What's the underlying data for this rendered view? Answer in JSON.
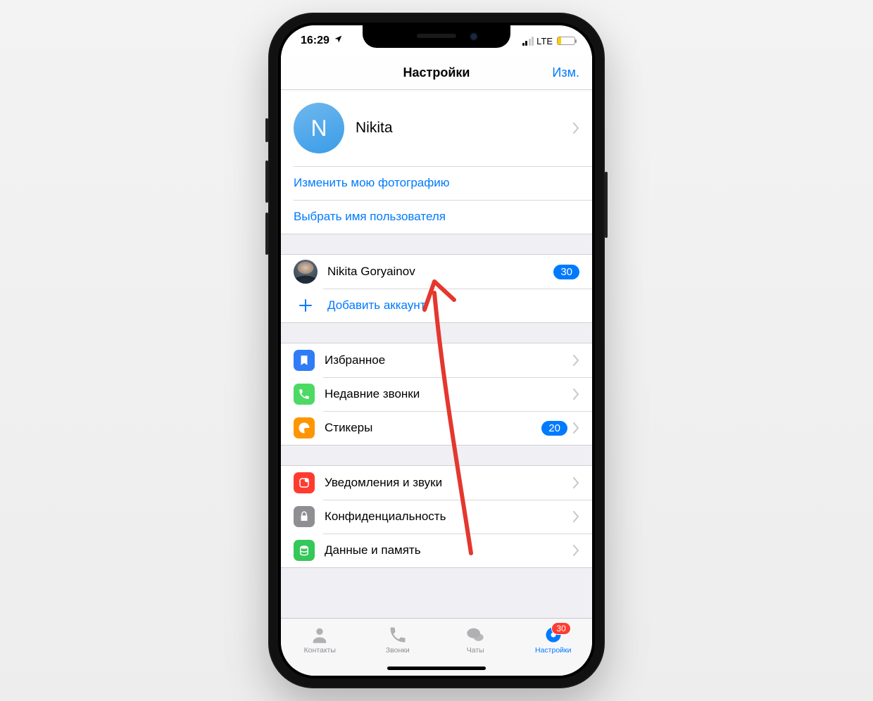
{
  "status": {
    "time": "16:29",
    "carrier": "LTE"
  },
  "nav": {
    "title": "Настройки",
    "edit": "Изм."
  },
  "profile": {
    "initial": "N",
    "name": "Nikita"
  },
  "links": {
    "change_photo": "Изменить мою фотографию",
    "choose_username": "Выбрать имя пользователя"
  },
  "accounts": {
    "item_name": "Nikita Goryainov",
    "item_badge": "30",
    "add_label": "Добавить аккаунт"
  },
  "settings": {
    "favorites": "Избранное",
    "recent_calls": "Недавние звонки",
    "stickers": "Стикеры",
    "stickers_badge": "20",
    "notifications": "Уведомления и звуки",
    "privacy": "Конфиденциальность",
    "data": "Данные и память"
  },
  "tabs": {
    "contacts": "Контакты",
    "calls": "Звонки",
    "chats": "Чаты",
    "settings": "Настройки",
    "settings_badge": "30"
  }
}
